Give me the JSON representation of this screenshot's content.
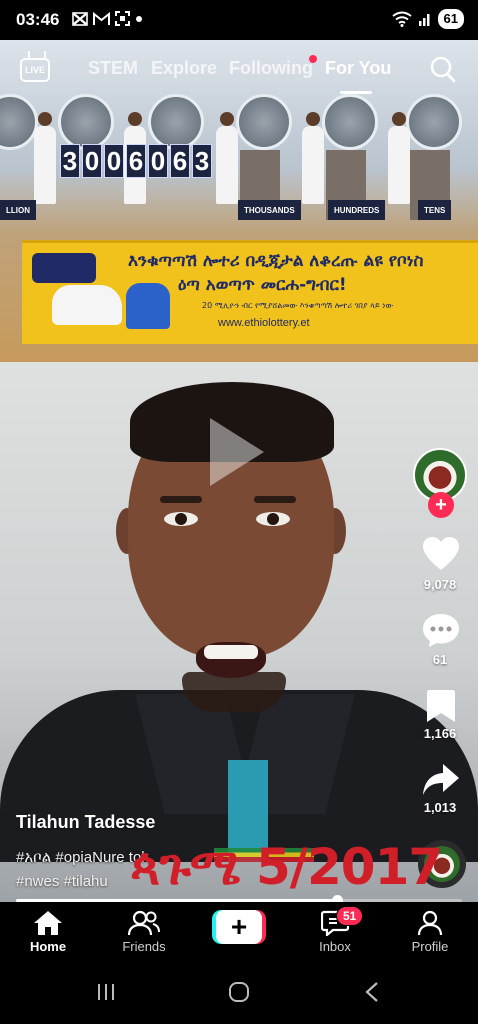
{
  "status_bar": {
    "time": "03:46",
    "notification_icons": [
      "envelope-x-icon",
      "gmail-icon",
      "screenshot-icon",
      "dot-icon"
    ],
    "battery": "61"
  },
  "top_nav": {
    "live_label": "LIVE",
    "tabs": [
      {
        "label": "STEM",
        "active": false
      },
      {
        "label": "Explore",
        "active": false
      },
      {
        "label": "Following",
        "active": false
      },
      {
        "label": "For You",
        "active": true
      }
    ]
  },
  "video_scene": {
    "draw_digits": [
      "3",
      "0",
      "0",
      "6",
      "0",
      "6",
      "3"
    ],
    "place_signs": [
      "LLION",
      "THOUSANDS",
      "HUNDREDS",
      "TENS"
    ],
    "banner_line1": "እንቁጣጣሽ ሎተሪ በዲጂታል ለቆረጡ ልዩ የቦነስ",
    "banner_line2": "ዕጣ አወጣጥ መርሐ-ግብር!",
    "banner_small": "20 ሚሊዮን ብር የሚያሸልመው እንቁጣጣሽ ሎተሪ ገበያ ላይ ነው",
    "banner_url": "www.ethiolottery.et"
  },
  "right_rail": {
    "likes": "9,078",
    "comments": "61",
    "saves": "1,166",
    "shares": "1,013"
  },
  "caption": {
    "author": "Tilahun Tadesse",
    "hashtags_line1": "#አቦል #opiaNure tok",
    "hashtags_line2": "#nwes #tilahu",
    "date_overlay": "ጳጉሜ 5/2017"
  },
  "playback": {
    "progress": 0.72
  },
  "bottom_nav": {
    "items": [
      {
        "label": "Home",
        "active": true
      },
      {
        "label": "Friends",
        "active": false
      },
      {
        "label": "Inbox",
        "active": false,
        "badge": "51"
      },
      {
        "label": "Profile",
        "active": false
      }
    ]
  },
  "colors": {
    "accent": "#fe2c55",
    "cyan": "#25f4ee"
  }
}
